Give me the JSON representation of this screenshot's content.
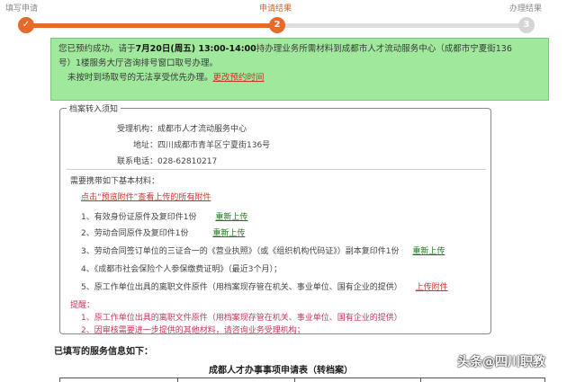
{
  "steps": [
    {
      "label": "填写申请",
      "number": "✓",
      "state": "done"
    },
    {
      "label": "申请结果",
      "number": "2",
      "state": "active"
    },
    {
      "label": "办理结果",
      "number": "3",
      "state": "todo"
    }
  ],
  "notice": {
    "line1_pre": "您已预约成功。请于",
    "date_time": "7月20日(周五) 13:00-14:00",
    "line1_post": "持办理业务所需材料到成都市人才流动服务中心（成都市宁夏街136",
    "line2": "号）1楼服务大厅咨询排号窗口取号办理。",
    "line3": "未按时到场取号的无法享受优先办理。",
    "change_link": "更改预约时间"
  },
  "box": {
    "legend": "档案转入须知",
    "agency_label": "受理机构：",
    "agency_value": "成都市人才流动服务中心",
    "address_label": "地址：",
    "address_value": "四川成都市青羊区宁夏街136号",
    "phone_label": "联系电话：",
    "phone_value": "028-62810217",
    "materials_title": "需要携带如下基本材料：",
    "preview_link": "点击“预览附件”查看上传的所有附件",
    "items": [
      {
        "text": "1、有效身份证原件及复印件1份",
        "link": "重新上传"
      },
      {
        "text": "2、劳动合同原件及复印件1份",
        "link": "重新上传"
      },
      {
        "text": "3、劳动合同签订单位的三证合一的《营业执照》（或《组织机构代码证》）副本复印件1份",
        "link": "重新上传"
      },
      {
        "text": "4、《成都市社会保险个人参保缴费证明》（最近3个月）；",
        "link": ""
      },
      {
        "text": "5、原工作单位出具的离职文件原件（用档案现存管在机关、事业单位、国有企业的提供）",
        "link": "上传附件"
      }
    ],
    "remind_title": "提醒：",
    "remind_items": [
      "1、原工作单位出具的离职文件原件（用档案现存管在机关、事业单位、国有企业的提供）",
      "2、因审核需要进一步提供的其他材料，请咨询业务受理机构；"
    ]
  },
  "filled_title": "已填写的服务信息如下：",
  "table_title": "成都人才办事事项申请表（转档案）",
  "watermark": "头条@四川职教"
}
